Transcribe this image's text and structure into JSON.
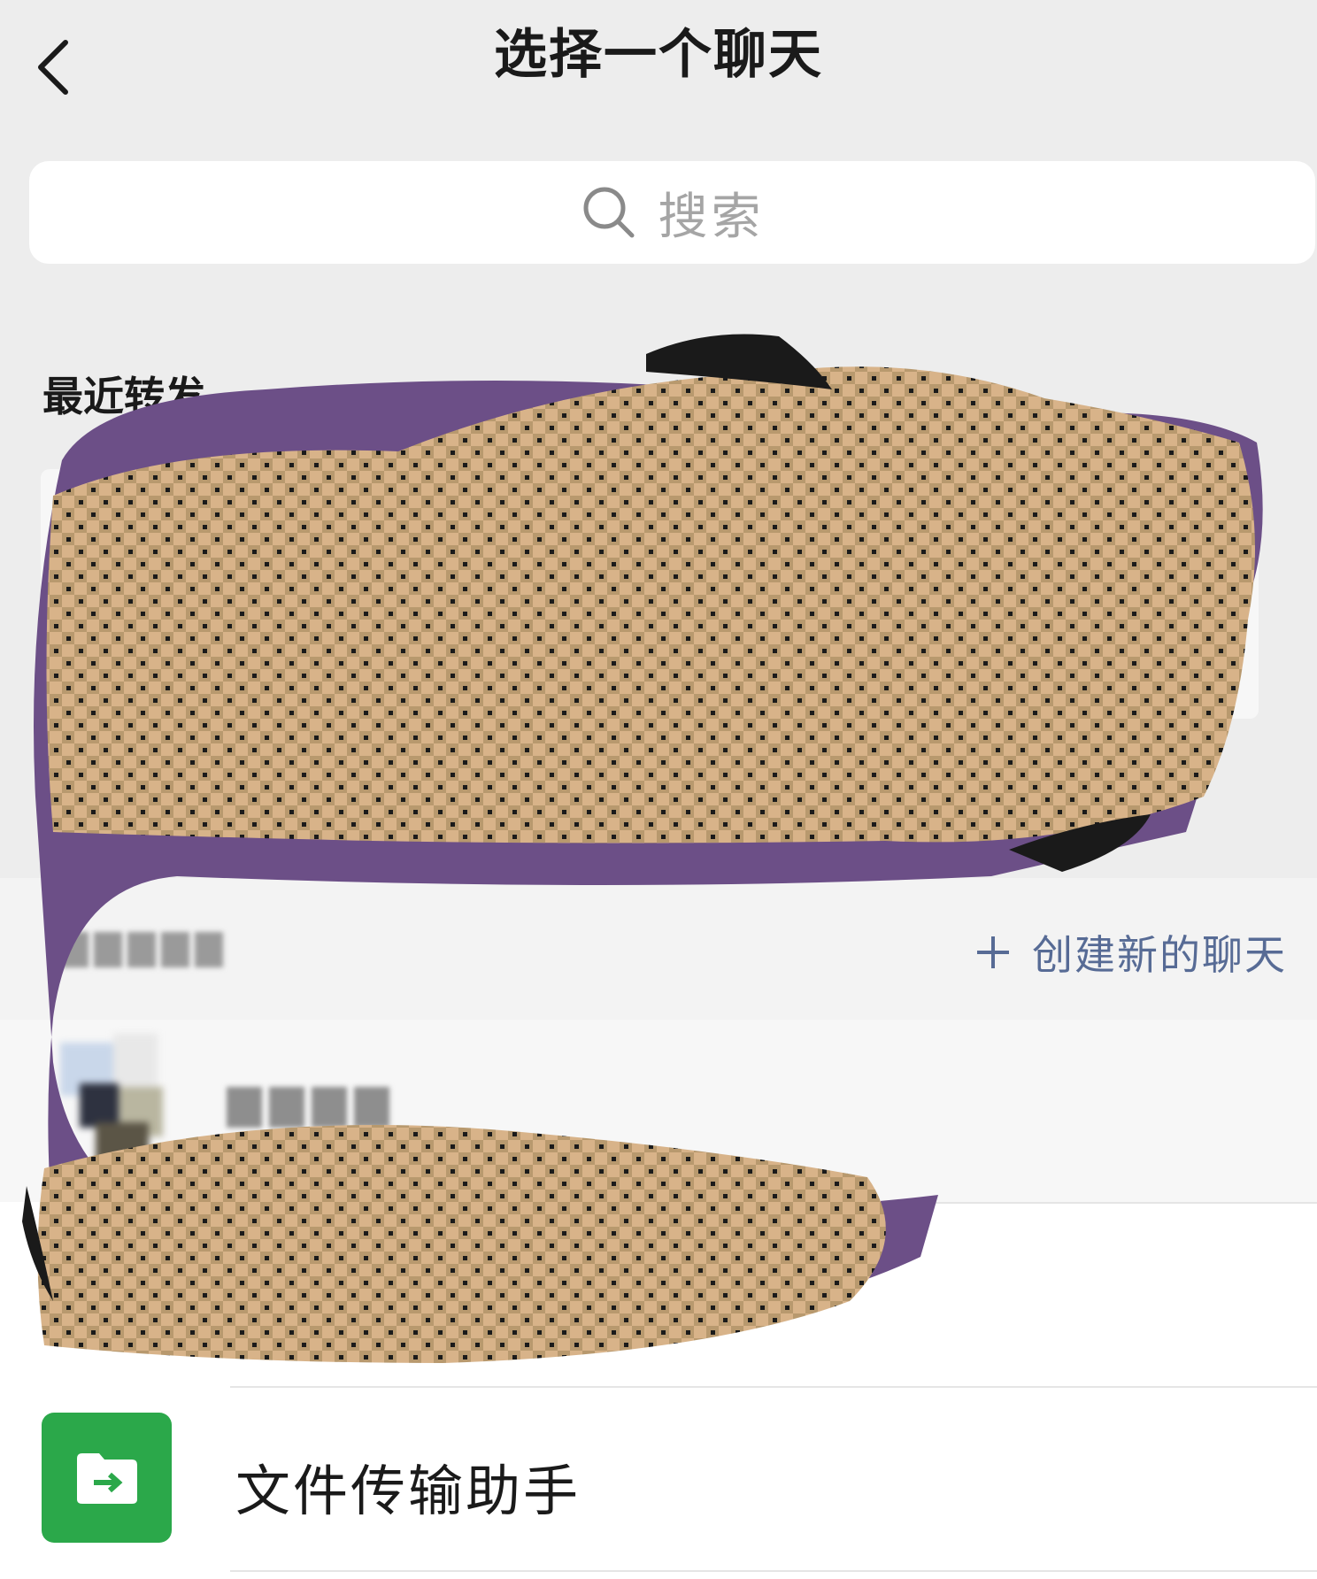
{
  "header": {
    "title": "选择一个聊天",
    "back_icon": "chevron-left-icon"
  },
  "search": {
    "placeholder": "搜索",
    "icon": "search-icon"
  },
  "recent_forwards": {
    "label": "最近转发"
  },
  "recent_chats": {
    "new_chat_label": "创建新的聊天",
    "new_chat_icon": "plus-icon"
  },
  "contacts": [
    {
      "name": "文件传输助手",
      "icon": "file-transfer-icon",
      "icon_color": "#2ba84a"
    }
  ],
  "colors": {
    "background": "#ededed",
    "accent_link": "#576b95",
    "file_transfer_green": "#2ba84a"
  }
}
